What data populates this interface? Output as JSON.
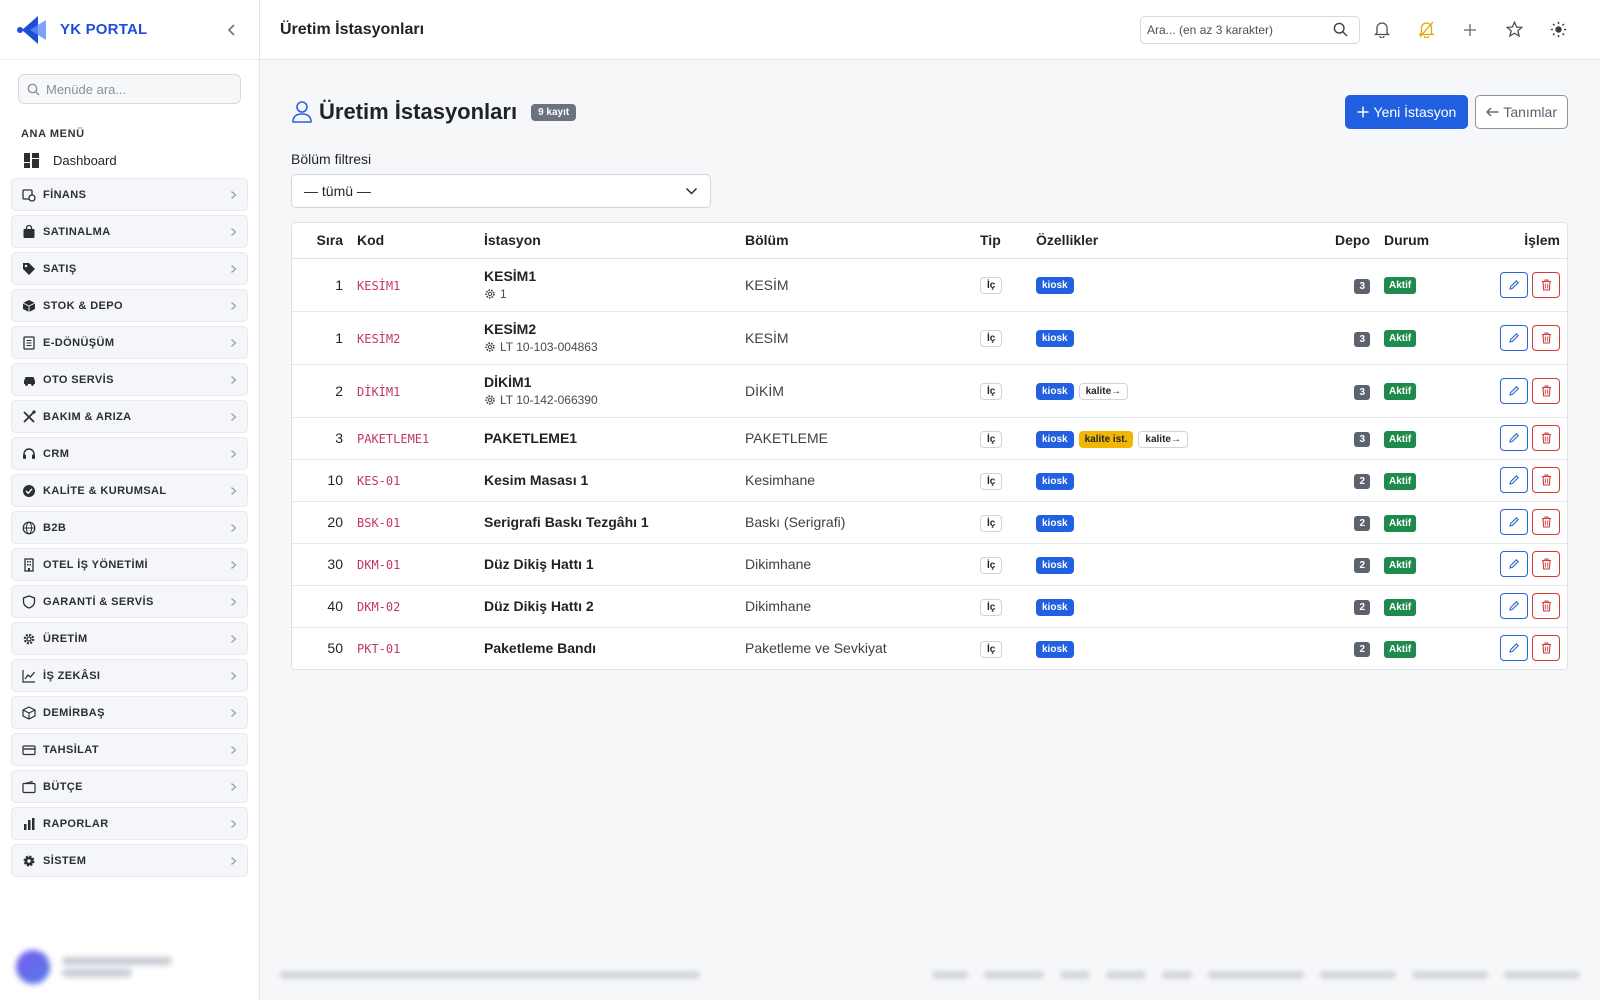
{
  "sidebar": {
    "brand": "YK PORTAL",
    "search_placeholder": "Menüde ara...",
    "menu_title": "ANA MENÜ",
    "dashboard": "Dashboard",
    "items": [
      {
        "label": "FİNANS",
        "icon": "finance-icon"
      },
      {
        "label": "SATINALMA",
        "icon": "bag-icon"
      },
      {
        "label": "SATIŞ",
        "icon": "tag-icon"
      },
      {
        "label": "STOK & DEPO",
        "icon": "box-icon"
      },
      {
        "label": "E-DÖNÜŞÜM",
        "icon": "document-icon"
      },
      {
        "label": "OTO SERVİS",
        "icon": "car-icon"
      },
      {
        "label": "BAKIM & ARIZA",
        "icon": "tools-icon"
      },
      {
        "label": "CRM",
        "icon": "headset-icon"
      },
      {
        "label": "KALİTE & KURUMSAL",
        "icon": "badge-check-icon"
      },
      {
        "label": "B2B",
        "icon": "globe-icon"
      },
      {
        "label": "OTEL İŞ YÖNETİMİ",
        "icon": "building-icon"
      },
      {
        "label": "GARANTİ & SERVİS",
        "icon": "shield-icon"
      },
      {
        "label": "ÜRETİM",
        "icon": "gear-icon"
      },
      {
        "label": "İŞ ZEKÂSI",
        "icon": "chart-line-icon"
      },
      {
        "label": "DEMİRBAŞ",
        "icon": "cube-icon"
      },
      {
        "label": "TAHSİLAT",
        "icon": "credit-card-icon"
      },
      {
        "label": "BÜTÇE",
        "icon": "wallet-icon"
      },
      {
        "label": "RAPORLAR",
        "icon": "bar-chart-icon"
      },
      {
        "label": "SİSTEM",
        "icon": "cog-icon"
      }
    ]
  },
  "topbar": {
    "title": "Üretim İstasyonları",
    "search_placeholder": "Ara... (en az 3 karakter)"
  },
  "page": {
    "title": "Üretim İstasyonları",
    "count": "9 kayıt",
    "new_button": "Yeni İstasyon",
    "back_button": "Tanımlar",
    "filter_label": "Bölüm filtresi",
    "filter_value": "— tümü —"
  },
  "table": {
    "headers": {
      "sira": "Sıra",
      "kod": "Kod",
      "istasyon": "İstasyon",
      "bolum": "Bölüm",
      "tip": "Tip",
      "ozellikler": "Özellikler",
      "depo": "Depo",
      "durum": "Durum",
      "islem": "İşlem"
    },
    "rows": [
      {
        "sira": "1",
        "kod": "KESİM1",
        "istasyon": "KESİM1",
        "sub": "1",
        "bolum": "KESİM",
        "tip": "İç",
        "tags": [
          {
            "t": "kiosk",
            "c": "blue"
          }
        ],
        "depo": "3",
        "durum": "Aktif"
      },
      {
        "sira": "1",
        "kod": "KESİM2",
        "istasyon": "KESİM2",
        "sub": "LT 10-103-004863",
        "bolum": "KESİM",
        "tip": "İç",
        "tags": [
          {
            "t": "kiosk",
            "c": "blue"
          }
        ],
        "depo": "3",
        "durum": "Aktif"
      },
      {
        "sira": "2",
        "kod": "DİKİM1",
        "istasyon": "DİKİM1",
        "sub": "LT 10-142-066390",
        "bolum": "DİKİM",
        "tip": "İç",
        "tags": [
          {
            "t": "kiosk",
            "c": "blue"
          },
          {
            "t": "kalite→",
            "c": "outline"
          }
        ],
        "depo": "3",
        "durum": "Aktif"
      },
      {
        "sira": "3",
        "kod": "PAKETLEME1",
        "istasyon": "PAKETLEME1",
        "sub": "",
        "bolum": "PAKETLEME",
        "tip": "İç",
        "tags": [
          {
            "t": "kiosk",
            "c": "blue"
          },
          {
            "t": "kalite ist.",
            "c": "yellow"
          },
          {
            "t": "kalite→",
            "c": "outline"
          }
        ],
        "depo": "3",
        "durum": "Aktif"
      },
      {
        "sira": "10",
        "kod": "KES-01",
        "istasyon": "Kesim Masası 1",
        "sub": "",
        "bolum": "Kesimhane",
        "tip": "İç",
        "tags": [
          {
            "t": "kiosk",
            "c": "blue"
          }
        ],
        "depo": "2",
        "durum": "Aktif"
      },
      {
        "sira": "20",
        "kod": "BSK-01",
        "istasyon": "Serigrafi Baskı Tezgâhı 1",
        "sub": "",
        "bolum": "Baskı (Serigrafi)",
        "tip": "İç",
        "tags": [
          {
            "t": "kiosk",
            "c": "blue"
          }
        ],
        "depo": "2",
        "durum": "Aktif"
      },
      {
        "sira": "30",
        "kod": "DKM-01",
        "istasyon": "Düz Dikiş Hattı 1",
        "sub": "",
        "bolum": "Dikimhane",
        "tip": "İç",
        "tags": [
          {
            "t": "kiosk",
            "c": "blue"
          }
        ],
        "depo": "2",
        "durum": "Aktif"
      },
      {
        "sira": "40",
        "kod": "DKM-02",
        "istasyon": "Düz Dikiş Hattı 2",
        "sub": "",
        "bolum": "Dikimhane",
        "tip": "İç",
        "tags": [
          {
            "t": "kiosk",
            "c": "blue"
          }
        ],
        "depo": "2",
        "durum": "Aktif"
      },
      {
        "sira": "50",
        "kod": "PKT-01",
        "istasyon": "Paketleme Bandı",
        "sub": "",
        "bolum": "Paketleme ve Sevkiyat",
        "tip": "İç",
        "tags": [
          {
            "t": "kiosk",
            "c": "blue"
          }
        ],
        "depo": "2",
        "durum": "Aktif"
      }
    ]
  },
  "colors": {
    "primary": "#1f5fe0",
    "kod": "#c2356e",
    "success": "#1e8a4c",
    "warning": "#f2b705",
    "danger": "#d23a3a"
  }
}
